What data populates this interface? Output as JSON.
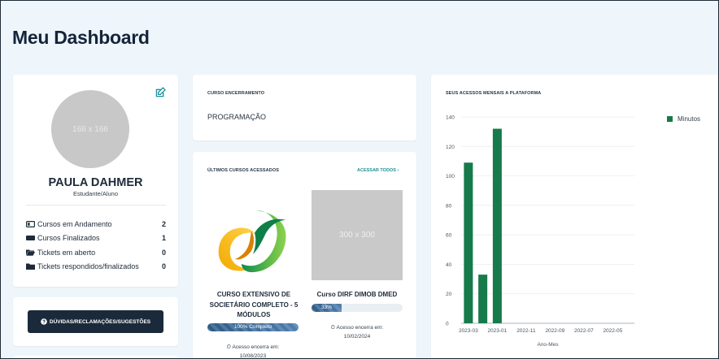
{
  "page": {
    "title": "Meu Dashboard"
  },
  "profile": {
    "avatar_placeholder": "166 x 166",
    "name": "PAULA DAHMER",
    "role": "Estudante/Aluno",
    "stats": [
      {
        "icon": "screen-icon",
        "label": "Cursos em Andamento",
        "value": "2"
      },
      {
        "icon": "laptop-icon",
        "label": "Cursos Finalizados",
        "value": "1"
      },
      {
        "icon": "folder-open-icon",
        "label": "Tickets em aberto",
        "value": "0"
      },
      {
        "icon": "folder-icon",
        "label": "Tickets respondidos/finalizados",
        "value": "0"
      }
    ]
  },
  "feedback": {
    "button_label": "DÚVIDAS/RECLAMAÇÕES/SUGESTÕES"
  },
  "closing_course": {
    "label": "CURSO ENCERRAMENTO",
    "value": "PROGRAMAÇÃO"
  },
  "recent": {
    "label": "ÚLTIMOS CURSOS ACESSADOS",
    "link": "ACESSAR TODOS ›",
    "courses": [
      {
        "title_lines": [
          "CURSO EXTENSIVO DE",
          "SOCIETÁRIO COMPLETO - 5",
          "MÓDULOS"
        ],
        "progress": 100,
        "progress_label": "100% Completo",
        "access_label": "Acesso encerra em:",
        "access_date": "10/08/2023"
      },
      {
        "title_lines": [
          "Curso DIRF DIMOB DMED"
        ],
        "thumb_placeholder": "300 x 300",
        "progress": 33,
        "progress_label": "33%",
        "access_label": "Acesso encerra em:",
        "access_date": "10/02/2024"
      }
    ]
  },
  "colors": {
    "bar": "#177a4b",
    "dark_button": "#1b2a3b",
    "progress": "#3b6a99",
    "link": "#1d8f9a"
  },
  "chart_data": {
    "type": "bar",
    "title": "SEUS ACESSOS MENSAIS A PLATAFORMA",
    "xlabel": "Ano-Mes",
    "ylabel": "",
    "categories": [
      "2023-03",
      "2023-02",
      "2023-01",
      "2022-12",
      "2022-11",
      "2022-10",
      "2022-09",
      "2022-08",
      "2022-07",
      "2022-06",
      "2022-05",
      "2022-04"
    ],
    "tick_labels": [
      "2023-03",
      "2023-01",
      "2022-11",
      "2022-09",
      "2022-07",
      "2022-05"
    ],
    "series": [
      {
        "name": "Minutos",
        "values": [
          109,
          33,
          132,
          0,
          0,
          0,
          0,
          0,
          0,
          0,
          0,
          0
        ]
      }
    ],
    "ylim": [
      0,
      140
    ],
    "yticks": [
      0,
      20,
      40,
      60,
      80,
      100,
      120,
      140
    ],
    "grid": true,
    "legend": "top-right"
  }
}
